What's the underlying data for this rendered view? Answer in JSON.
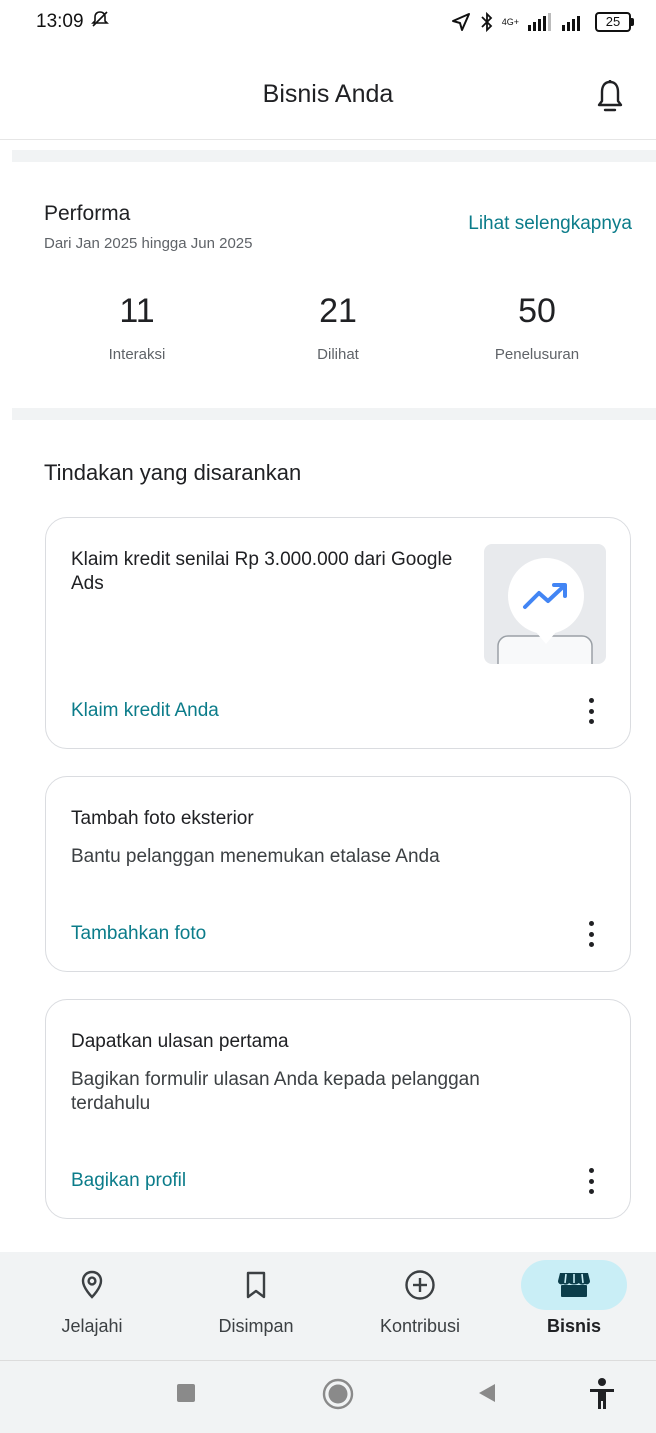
{
  "status_bar": {
    "time": "13:09",
    "battery": "25",
    "network_label_top": "4G+"
  },
  "app_bar": {
    "title": "Bisnis Anda"
  },
  "performance": {
    "title": "Performa",
    "subtitle": "Dari Jan 2025 hingga Jun 2025",
    "more_link": "Lihat selengkapnya",
    "stats": [
      {
        "value": "11",
        "label": "Interaksi"
      },
      {
        "value": "21",
        "label": "Dilihat"
      },
      {
        "value": "50",
        "label": "Penelusuran"
      }
    ]
  },
  "suggestions": {
    "title": "Tindakan yang disarankan",
    "cards": [
      {
        "title": "Klaim kredit senilai Rp 3.000.000 dari Google Ads",
        "description": "",
        "action": "Klaim kredit Anda",
        "image_icon": "trending-up-icon"
      },
      {
        "title": "Tambah foto eksterior",
        "description": "Bantu pelanggan menemukan etalase Anda",
        "action": "Tambahkan foto"
      },
      {
        "title": "Dapatkan ulasan pertama",
        "description": "Bagikan formulir ulasan Anda kepada pelanggan terdahulu",
        "action": "Bagikan profil"
      }
    ]
  },
  "bottom_nav": {
    "items": [
      {
        "label": "Jelajahi",
        "icon": "location-pin-icon",
        "active": false
      },
      {
        "label": "Disimpan",
        "icon": "bookmark-icon",
        "active": false
      },
      {
        "label": "Kontribusi",
        "icon": "add-circle-icon",
        "active": false
      },
      {
        "label": "Bisnis",
        "icon": "storefront-icon",
        "active": true
      }
    ]
  },
  "colors": {
    "accent_link": "#0b7c8a",
    "active_nav_pill": "#c9eef6",
    "chart_icon": "#4285f4"
  }
}
